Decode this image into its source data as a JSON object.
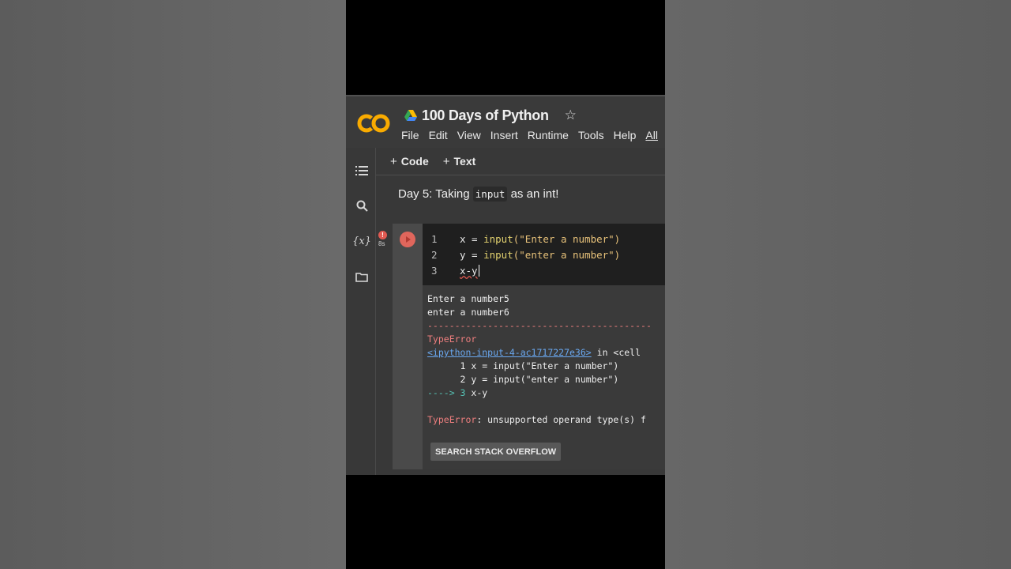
{
  "app": {
    "notebook_title": "100 Days of Python",
    "star_icon": "star-icon",
    "menu": [
      "File",
      "Edit",
      "View",
      "Insert",
      "Runtime",
      "Tools",
      "Help",
      "All"
    ]
  },
  "toolbar": {
    "code_label": "Code",
    "text_label": "Text"
  },
  "text_cell": {
    "prefix": "Day 5: Taking ",
    "code": "input",
    "suffix": " as an int!"
  },
  "cell_status": {
    "error_badge": "!",
    "exec_time": "8s"
  },
  "code_cell": {
    "lines": [
      {
        "num": "1",
        "var": "x",
        "op": " = ",
        "fn": "input",
        "arg": "(\"Enter a number\")"
      },
      {
        "num": "2",
        "var": "y",
        "op": " = ",
        "fn": "input",
        "arg": "(\"enter a number\")"
      },
      {
        "num": "3",
        "code": "x-y"
      }
    ]
  },
  "output": {
    "stdout": [
      "Enter a number5",
      "enter a number6"
    ],
    "separator": "-----------------------------------------",
    "error_name": "TypeError",
    "trace_link": "<ipython-input-4-ac1717227e36>",
    "trace_link_suffix": " in <cell",
    "trace_lines": [
      "      1 x = input(\"Enter a number\")",
      "      2 y = input(\"enter a number\")"
    ],
    "arrow_line_prefix": "----> 3 ",
    "arrow_line_code": "x-y",
    "error_message_name": "TypeError",
    "error_message": ": unsupported operand type(s) f",
    "search_button": "SEARCH STACK OVERFLOW"
  },
  "colors": {
    "error": "#f07f7f",
    "link": "#6aa8f0",
    "arrow": "#56c4b6",
    "run_button": "#e0665c"
  }
}
